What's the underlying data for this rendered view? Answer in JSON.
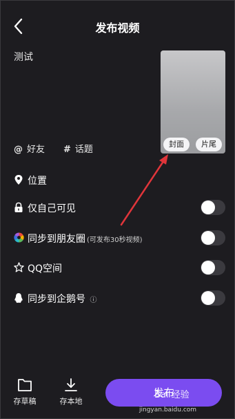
{
  "header": {
    "title": "发布视频"
  },
  "caption": {
    "text": "测试"
  },
  "cover": {
    "cover_label": "封面",
    "tail_label": "片尾"
  },
  "tags": {
    "friends_symbol": "@",
    "friends_label": "好友",
    "topic_symbol": "#",
    "topic_label": "话题"
  },
  "settings": [
    {
      "label": "位置",
      "note": "",
      "has_toggle": false,
      "icon": "location-pin-icon"
    },
    {
      "label": "仅自己可见",
      "note": "",
      "has_toggle": true,
      "on": false,
      "icon": "lock-icon"
    },
    {
      "label": "同步到朋友圈",
      "note": "(可发布30秒视频)",
      "has_toggle": true,
      "on": false,
      "icon": "wechat-moments-icon"
    },
    {
      "label": "QQ空间",
      "note": "",
      "has_toggle": true,
      "on": false,
      "icon": "qzone-star-icon"
    },
    {
      "label": "同步到企鹅号",
      "note": "ⓘ",
      "has_toggle": true,
      "on": false,
      "icon": "penguin-icon"
    }
  ],
  "bottom": {
    "drafts_label": "存草稿",
    "local_label": "存本地",
    "publish_label": "发布"
  },
  "watermark": {
    "text": "Bai 经验",
    "url": "jingyan.baidu.com"
  },
  "colors": {
    "background": "#1d1c20",
    "accent": "#7b4cf0",
    "arrow": "#e0353a"
  }
}
